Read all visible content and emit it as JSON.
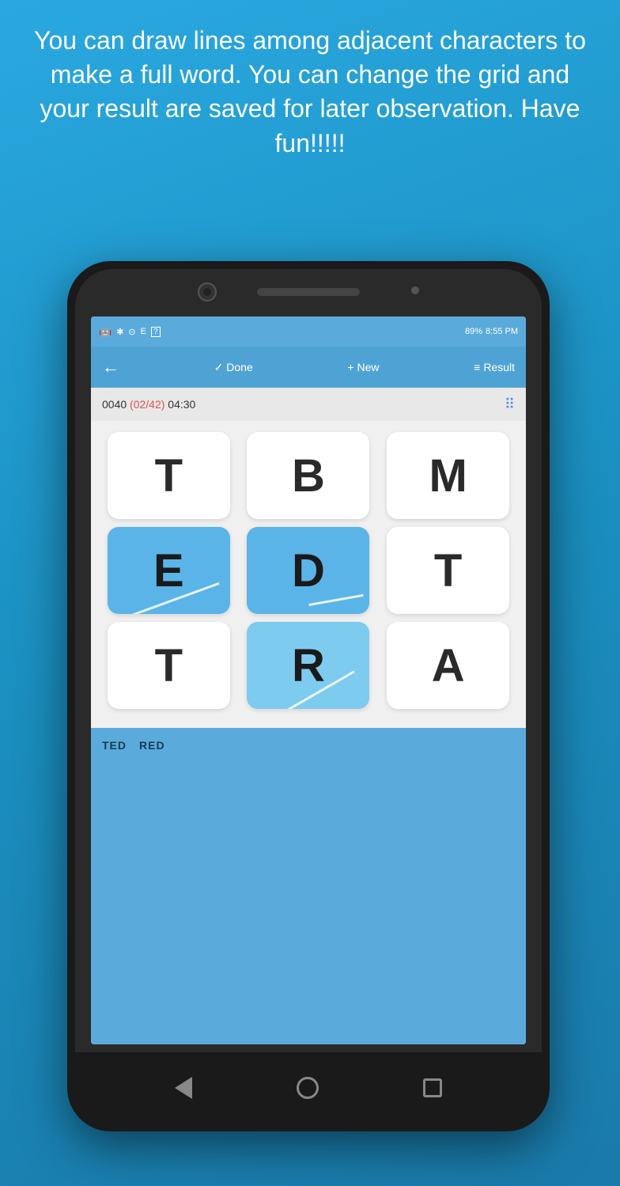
{
  "header": {
    "text": "You can draw lines among adjacent characters to make a full word. You can change the grid and your result are saved for later observation. Have fun!!!!!"
  },
  "status_bar": {
    "android_icon": "🤖",
    "bluetooth": "✱",
    "clock": "⊙",
    "signal": "E",
    "lock": "?",
    "battery": "89%",
    "time": "8:55 PM"
  },
  "action_bar": {
    "back_icon": "←",
    "done_label": "✓ Done",
    "new_label": "+ New",
    "result_icon": "≡",
    "result_label": "Result"
  },
  "puzzle_header": {
    "id": "0040",
    "count": "(02/42)",
    "timer": "04:30",
    "grid_icon": "⠿"
  },
  "grid": {
    "rows": [
      [
        "T",
        "B",
        "M"
      ],
      [
        "E",
        "D",
        "T"
      ],
      [
        "T",
        "R",
        "A"
      ]
    ],
    "selected": [
      [
        false,
        false,
        false
      ],
      [
        true,
        true,
        false
      ],
      [
        false,
        true,
        false
      ]
    ]
  },
  "found_words": [
    "TED",
    "RED"
  ],
  "nav": {
    "back": "◁",
    "home": "○",
    "recent": "□"
  }
}
